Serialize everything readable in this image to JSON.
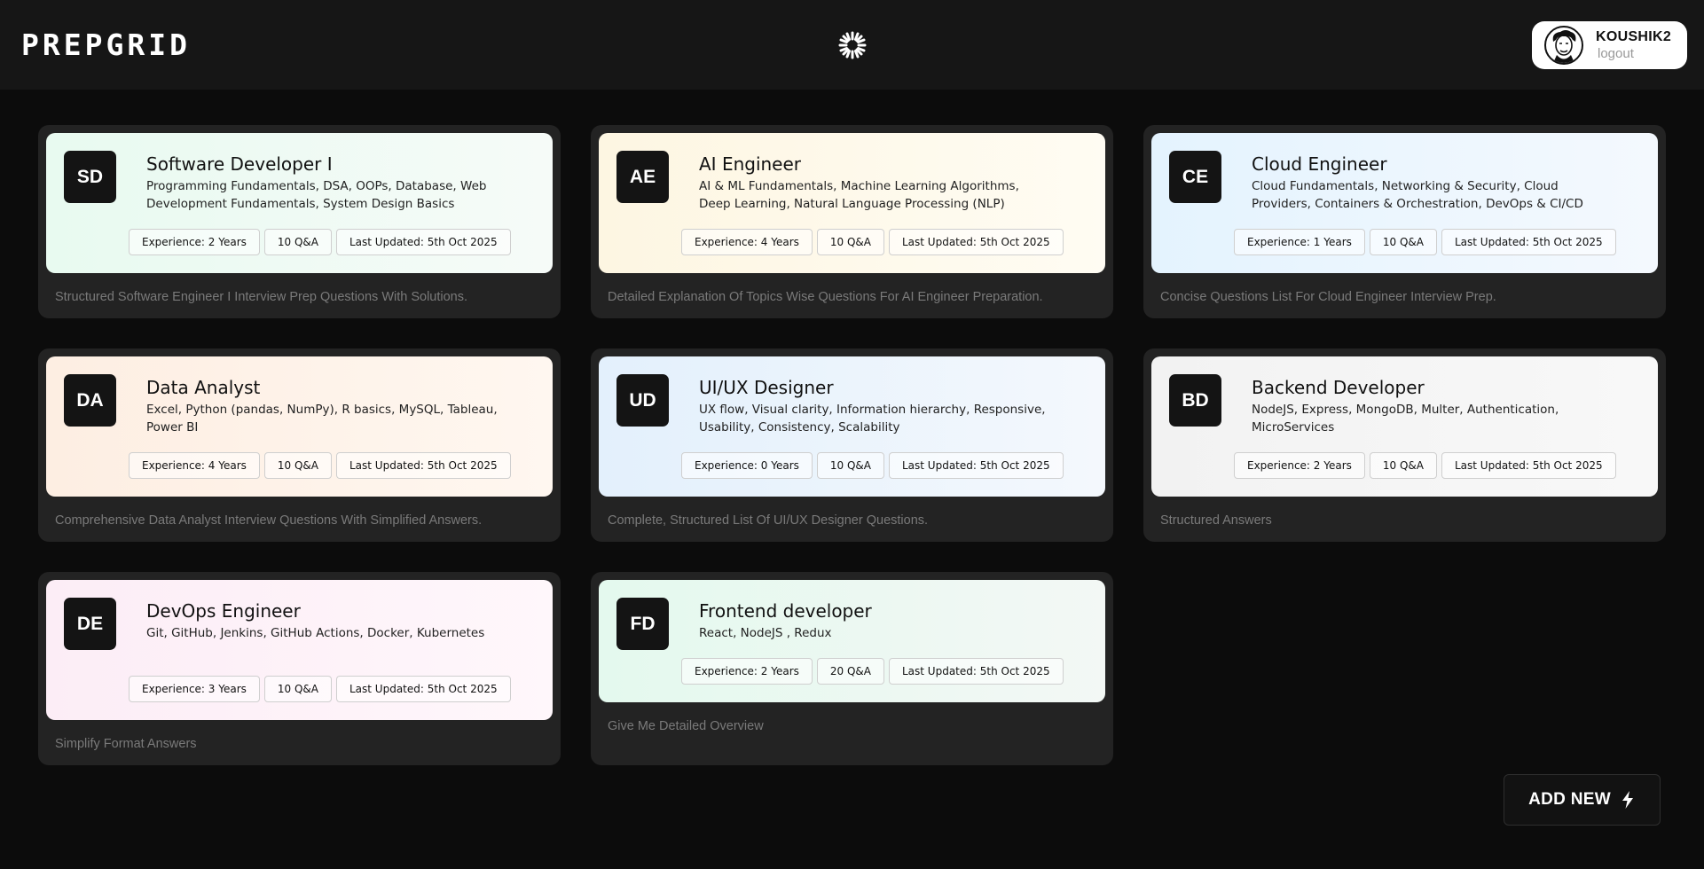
{
  "app": {
    "logo": "PREPGRID"
  },
  "user": {
    "name": "KOUSHIK2",
    "logout_label": "logout"
  },
  "sessions": [
    {
      "initials": "SD",
      "title": "Software Developer I",
      "topics": "Programming Fundamentals, DSA, OOPs, Database, Web Development Fundamentals, System Design Basics",
      "experience": "Experience: 2 Years",
      "qa": "10 Q&A",
      "updated": "Last Updated: 5th Oct 2025",
      "description": "Structured Software Engineer I Interview Prep Questions With Solutions.",
      "theme": "#e8faf0"
    },
    {
      "initials": "AE",
      "title": "AI Engineer",
      "topics": "AI & ML Fundamentals, Machine Learning Algorithms, Deep Learning, Natural Language Processing (NLP)",
      "experience": "Experience: 4 Years",
      "qa": "10 Q&A",
      "updated": "Last Updated: 5th Oct 2025",
      "description": "Detailed Explanation Of Topics Wise Questions For AI Engineer Preparation.",
      "theme": "#fdf6e2"
    },
    {
      "initials": "CE",
      "title": "Cloud Engineer",
      "topics": "Cloud Fundamentals, Networking & Security, Cloud Providers, Containers & Orchestration, DevOps & CI/CD",
      "experience": "Experience: 1 Years",
      "qa": "10 Q&A",
      "updated": "Last Updated: 5th Oct 2025",
      "description": "Concise Questions List For Cloud Engineer Interview Prep.",
      "theme": "#e4f3fe"
    },
    {
      "initials": "DA",
      "title": "Data Analyst",
      "topics": "Excel, Python (pandas, NumPy), R basics, MySQL, Tableau, Power BI",
      "experience": "Experience: 4 Years",
      "qa": "10 Q&A",
      "updated": "Last Updated: 5th Oct 2025",
      "description": "Comprehensive Data Analyst Interview Questions With Simplified Answers.",
      "theme": "#fdeee2"
    },
    {
      "initials": "UD",
      "title": "UI/UX Designer",
      "topics": "UX flow, Visual clarity, Information hierarchy, Responsive, Usability, Consistency, Scalability",
      "experience": "Experience: 0 Years",
      "qa": "10 Q&A",
      "updated": "Last Updated: 5th Oct 2025",
      "description": "Complete, Structured List Of UI/UX Designer Questions.",
      "theme": "#e3f0fc"
    },
    {
      "initials": "BD",
      "title": "Backend Developer",
      "topics": "NodeJS, Express, MongoDB, Multer, Authentication, MicroServices",
      "experience": "Experience: 2 Years",
      "qa": "10 Q&A",
      "updated": "Last Updated: 5th Oct 2025",
      "description": "Structured Answers",
      "theme": "#f2f2f2"
    },
    {
      "initials": "DE",
      "title": "DevOps Engineer",
      "topics": "Git, GitHub, Jenkins, GitHub Actions, Docker, Kubernetes",
      "experience": "Experience: 3 Years",
      "qa": "10 Q&A",
      "updated": "Last Updated: 5th Oct 2025",
      "description": "Simplify Format Answers",
      "theme": "#fcedf6"
    },
    {
      "initials": "FD",
      "title": "Frontend developer",
      "topics": "React, NodeJS , Redux",
      "experience": "Experience: 2 Years",
      "qa": "20 Q&A",
      "updated": "Last Updated: 5th Oct 2025",
      "description": "Give Me Detailed Overview",
      "theme": "#e4f9ee"
    }
  ],
  "actions": {
    "add_new_label": "ADD NEW",
    "add_new_icon": "lightning-bolt-icon",
    "loading_icon": "spinner-icon",
    "avatar_icon": "user-avatar-icon"
  }
}
